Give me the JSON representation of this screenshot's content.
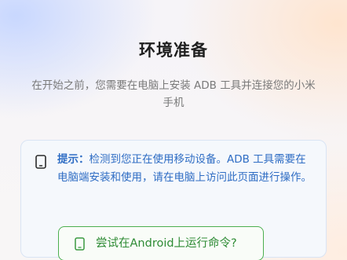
{
  "header": {
    "title": "环境准备",
    "subtitle": "在开始之前，您需要在电脑上安装 ADB 工具并连接您的小米手机"
  },
  "tip": {
    "label": "提示：",
    "text": "检测到您正在使用移动设备。ADB 工具需要在电脑端安装和使用，请在电脑上访问此页面进行操作。",
    "icon": "phone-icon",
    "accent_color": "#2f6dc4"
  },
  "action": {
    "label": "尝试在Android上运行命令?",
    "icon": "phone-icon",
    "accent_color": "#4caf50"
  }
}
